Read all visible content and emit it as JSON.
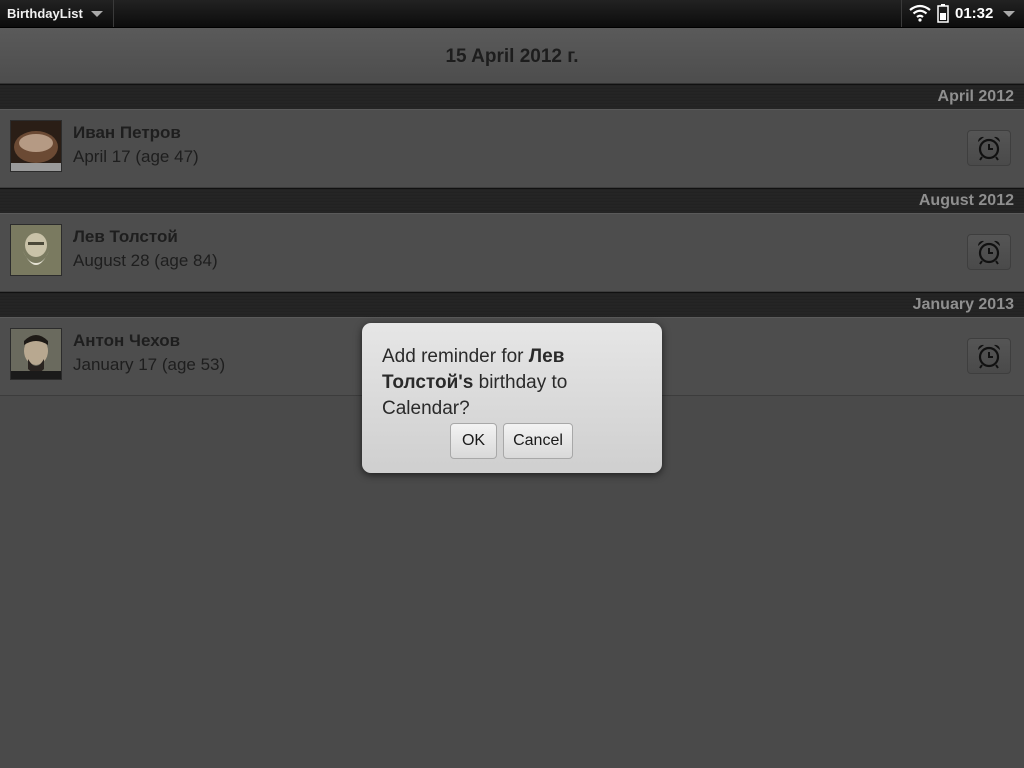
{
  "statusbar": {
    "app_name": "BirthdayList",
    "clock": "01:32"
  },
  "header": {
    "title": "15 April 2012 г."
  },
  "sections": [
    {
      "label": "April 2012",
      "items": [
        {
          "name": "Иван Петров",
          "date": "April 17 (age 47)"
        }
      ]
    },
    {
      "label": "August 2012",
      "items": [
        {
          "name": "Лев Толстой",
          "date": "August 28 (age 84)"
        }
      ]
    },
    {
      "label": "January 2013",
      "items": [
        {
          "name": "Антон Чехов",
          "date": "January 17 (age 53)"
        }
      ]
    }
  ],
  "dialog": {
    "prefix": "Add reminder for ",
    "bold": "Лев Толстой's",
    "suffix": " birthday to Calendar?",
    "ok_label": "OK",
    "cancel_label": "Cancel"
  },
  "icons": {
    "status_wifi": "wifi-icon",
    "status_battery": "battery-icon",
    "reminder": "alarm-clock-icon",
    "menu": "chevron-down-icon"
  },
  "colors": {
    "background": "#4a4a4a",
    "statusbar": "#111111",
    "dialog": "#dcdcdc",
    "section_text": "#8f8f8f"
  }
}
